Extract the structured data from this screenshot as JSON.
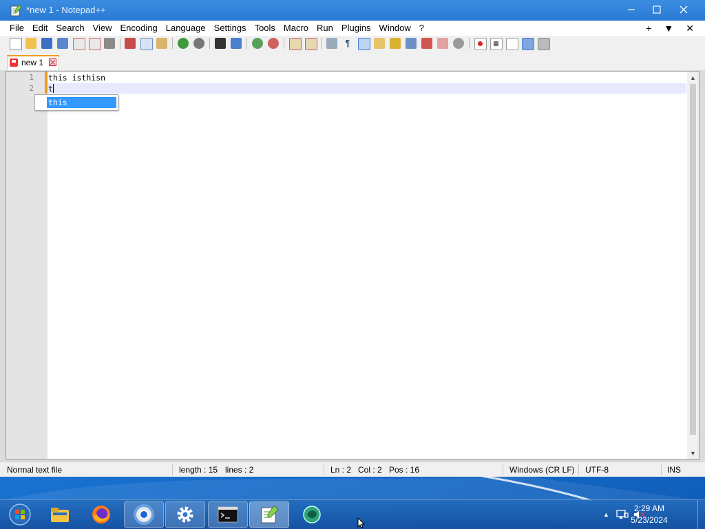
{
  "window": {
    "title": "*new 1 - Notepad++"
  },
  "menu": {
    "items": [
      "File",
      "Edit",
      "Search",
      "View",
      "Encoding",
      "Language",
      "Settings",
      "Tools",
      "Macro",
      "Run",
      "Plugins",
      "Window",
      "?"
    ],
    "right": {
      "plus": "+",
      "dropdown": "▼",
      "close": "✕"
    }
  },
  "tab": {
    "label": "new 1"
  },
  "editor": {
    "line_numbers": [
      "1",
      "2"
    ],
    "lines": [
      "this isthisn",
      "t"
    ]
  },
  "autocomplete": {
    "suggestion": "this"
  },
  "status": {
    "file_type": "Normal text file",
    "length": "length : 15",
    "lines": "lines : 2",
    "ln": "Ln : 2",
    "col": "Col : 2",
    "pos": "Pos : 16",
    "eol": "Windows (CR LF)",
    "encoding": "UTF-8",
    "mode": "INS"
  },
  "taskbar": {
    "time": "2:29 AM",
    "date": "5/23/2024",
    "apps": [
      "start-orb",
      "file-explorer",
      "firefox",
      "chrome",
      "settings",
      "command-prompt",
      "notepad-plus-plus",
      "app-circle"
    ]
  },
  "colors": {
    "accent_tab": "#f29a1e",
    "selection": "#3399ff",
    "current_line": "#e8e8ff"
  }
}
